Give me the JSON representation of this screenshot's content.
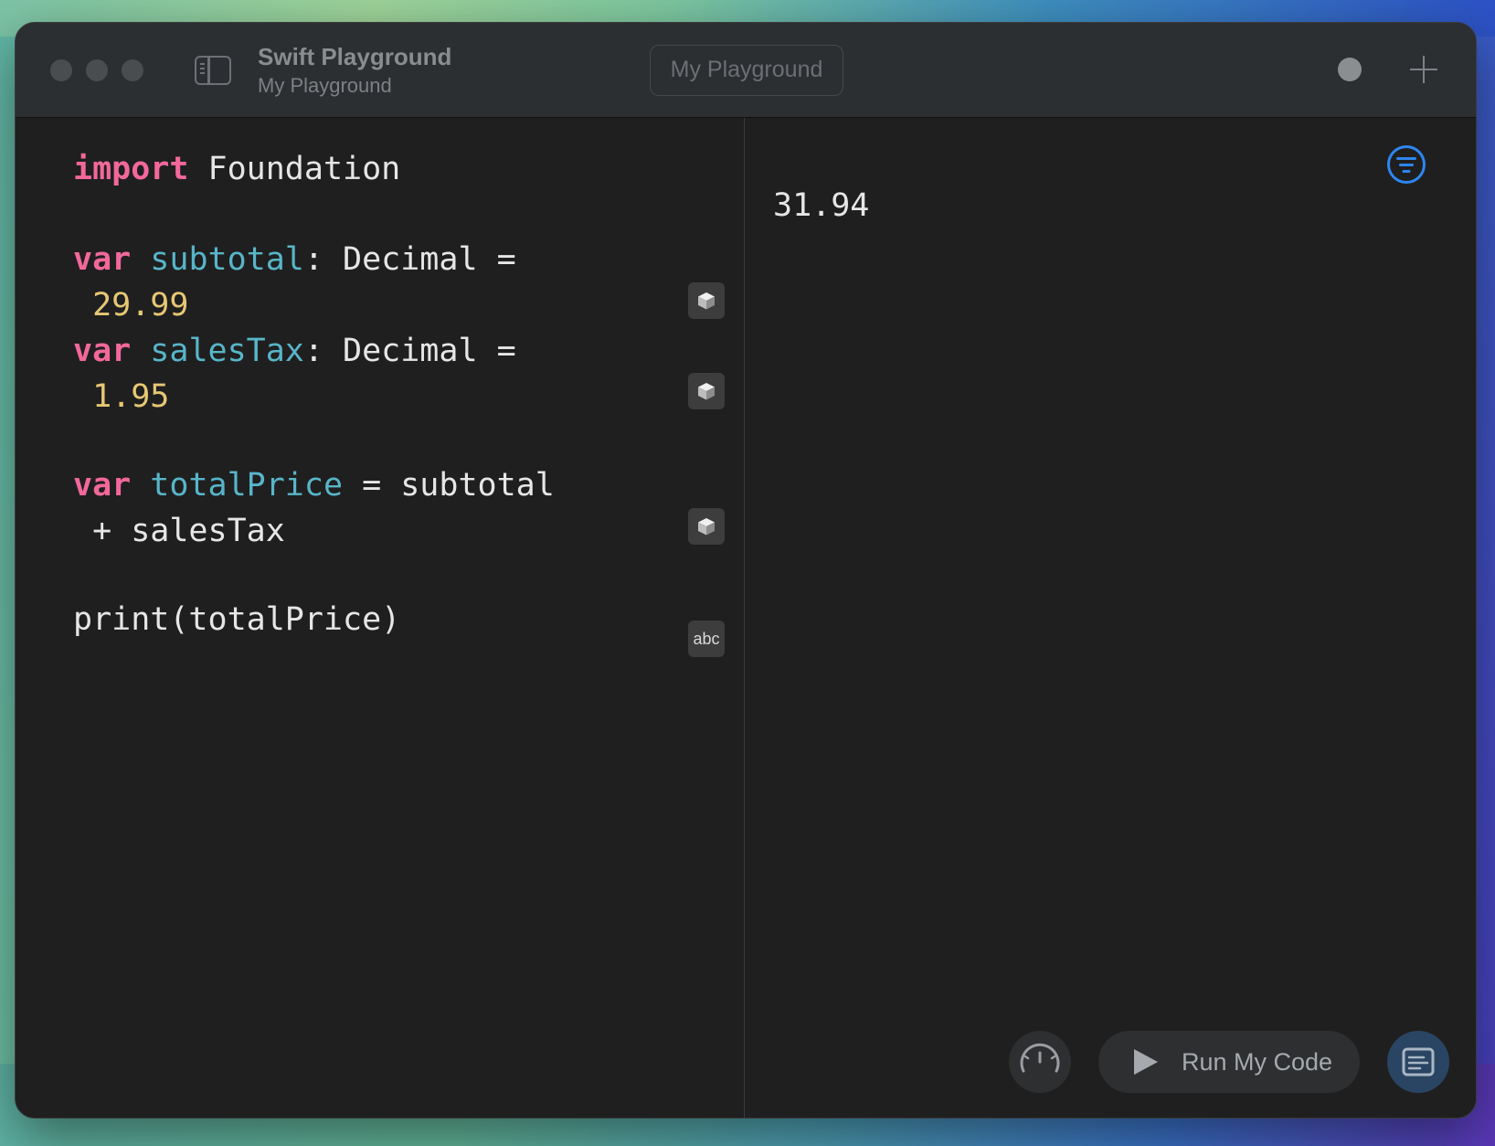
{
  "window": {
    "title": "Swift Playground",
    "subtitle": "My Playground",
    "document_name": "My Playground"
  },
  "editor": {
    "lines": [
      {
        "id": "import",
        "tokens": [
          {
            "t": "import",
            "k": "kw"
          },
          {
            "t": " Foundation",
            "k": "plain"
          }
        ]
      },
      {
        "id": "subtotal-1",
        "tokens": [
          {
            "t": "var",
            "k": "kw"
          },
          {
            "t": " ",
            "k": "plain"
          },
          {
            "t": "subtotal",
            "k": "ident"
          },
          {
            "t": ": Decimal =",
            "k": "plain"
          }
        ]
      },
      {
        "id": "subtotal-2",
        "tokens": [
          {
            "t": " ",
            "k": "plain"
          },
          {
            "t": "29.99",
            "k": "num"
          }
        ]
      },
      {
        "id": "salestax-1",
        "tokens": [
          {
            "t": "var",
            "k": "kw"
          },
          {
            "t": " ",
            "k": "plain"
          },
          {
            "t": "salesTax",
            "k": "ident"
          },
          {
            "t": ": Decimal =",
            "k": "plain"
          }
        ]
      },
      {
        "id": "salestax-2",
        "tokens": [
          {
            "t": " ",
            "k": "plain"
          },
          {
            "t": "1.95",
            "k": "num"
          }
        ]
      },
      {
        "id": "total-1",
        "tokens": [
          {
            "t": "var",
            "k": "kw"
          },
          {
            "t": " ",
            "k": "plain"
          },
          {
            "t": "totalPrice",
            "k": "ident"
          },
          {
            "t": " = subtotal",
            "k": "plain"
          }
        ]
      },
      {
        "id": "total-2",
        "tokens": [
          {
            "t": " + salesTax",
            "k": "plain"
          }
        ]
      },
      {
        "id": "print",
        "tokens": [
          {
            "t": "print(totalPrice)",
            "k": "plain"
          }
        ]
      }
    ],
    "gutter": {
      "subtotal_icon": "cube-icon",
      "salestax_icon": "cube-icon",
      "total_icon": "cube-icon",
      "print_label": "abc"
    }
  },
  "results": {
    "output": "31.94"
  },
  "toolbar": {
    "run_label": "Run My Code",
    "meter_icon": "speedometer-icon",
    "console_icon": "console-icon",
    "filter_icon": "filter-icon"
  },
  "colors": {
    "keyword": "#f2689b",
    "identifier": "#58b5c9",
    "number": "#e6c774",
    "accent": "#2f86f0"
  }
}
